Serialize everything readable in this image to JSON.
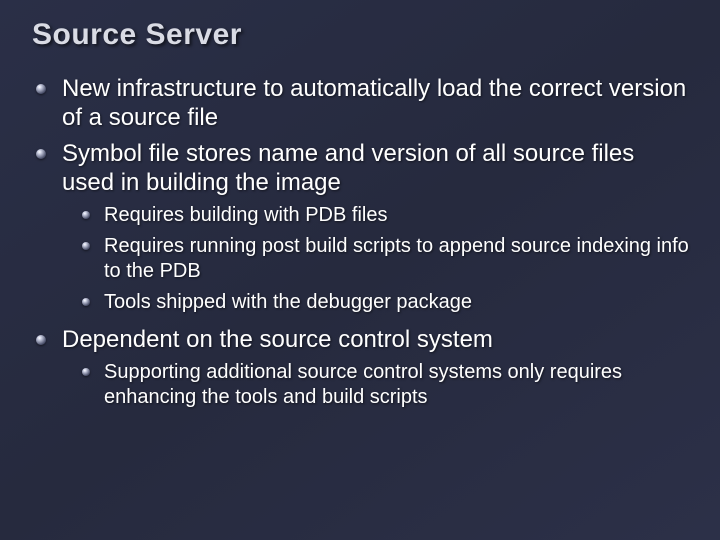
{
  "slide": {
    "title": "Source Server",
    "bullets": [
      {
        "text": "New infrastructure to automatically load the correct version of a source file"
      },
      {
        "text": "Symbol file stores name and version of all source files used in building the image",
        "children": [
          {
            "text": "Requires building with PDB files"
          },
          {
            "text": "Requires running post build scripts to append source indexing info to the PDB"
          },
          {
            "text": "Tools shipped with the debugger package"
          }
        ]
      },
      {
        "text": "Dependent on the source control system",
        "children": [
          {
            "text": "Supporting additional source control systems only requires enhancing the tools and build scripts"
          }
        ]
      }
    ]
  }
}
